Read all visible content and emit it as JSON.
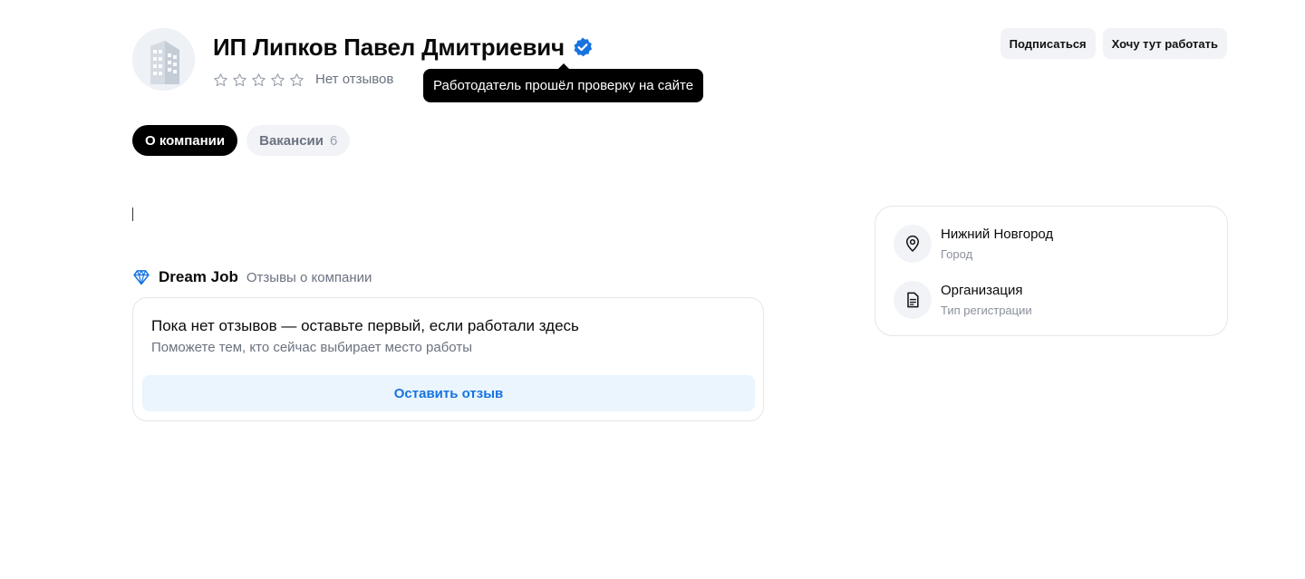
{
  "company": {
    "name": "ИП Липков Павел Дмитриевич",
    "rating_text": "Нет отзывов",
    "stars_filled": 0,
    "stars_total": 5
  },
  "tooltip": {
    "text": "Работодатель прошёл проверку на сайте"
  },
  "header_actions": {
    "subscribe_label": "Подписаться",
    "want_work_label": "Хочу тут работать"
  },
  "tabs": [
    {
      "label": "О компании",
      "count": ""
    },
    {
      "label": "Вакансии",
      "count": "6"
    }
  ],
  "reviews": {
    "brand": "Dream Job",
    "subtitle": "Отзывы о компании",
    "empty_title": "Пока нет отзывов — оставьте первый, если работали здесь",
    "empty_subtitle": "Поможете тем, кто сейчас выбирает место работы",
    "leave_review_label": "Оставить отзыв"
  },
  "info": {
    "city": {
      "value": "Нижний Новгород",
      "label": "Город",
      "icon": "location-pin-icon"
    },
    "registration": {
      "value": "Организация",
      "label": "Тип регистрации",
      "icon": "document-icon"
    }
  },
  "colors": {
    "verified": "#1673e0",
    "accent_text": "#1673e0",
    "button_bg": "#eaf5fe",
    "tab_active_bg": "#000000"
  }
}
